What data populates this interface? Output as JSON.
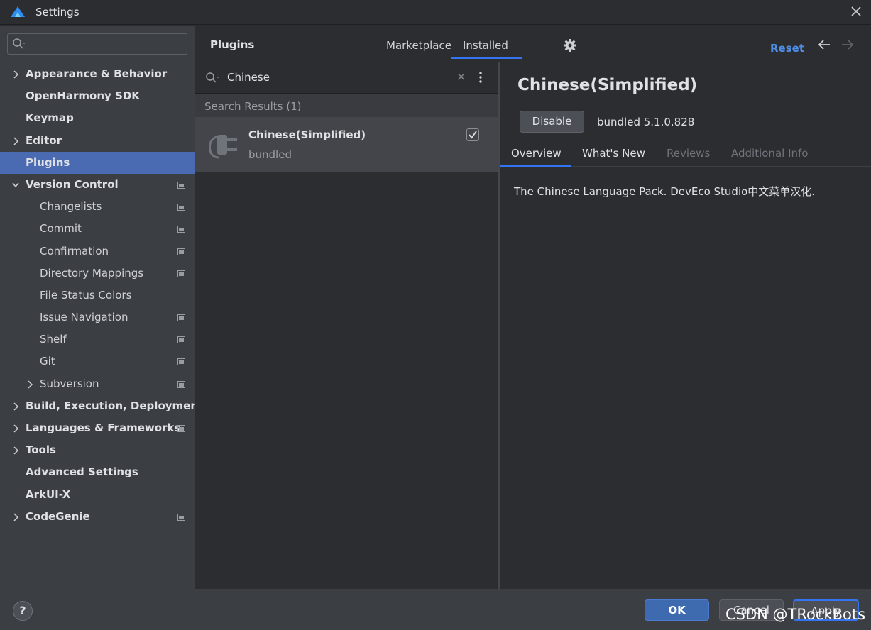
{
  "window": {
    "title": "Settings"
  },
  "sidebar": {
    "items": [
      {
        "label": "Appearance & Behavior",
        "level": 0,
        "expandable": true,
        "expanded": false
      },
      {
        "label": "OpenHarmony SDK",
        "level": 0,
        "expandable": false
      },
      {
        "label": "Keymap",
        "level": 0,
        "expandable": false
      },
      {
        "label": "Editor",
        "level": 0,
        "expandable": true,
        "expanded": false
      },
      {
        "label": "Plugins",
        "level": 0,
        "expandable": false,
        "selected": true
      },
      {
        "label": "Version Control",
        "level": 0,
        "expandable": true,
        "expanded": true,
        "project_icon": true
      },
      {
        "label": "Changelists",
        "level": 1,
        "project_icon": true
      },
      {
        "label": "Commit",
        "level": 1,
        "project_icon": true
      },
      {
        "label": "Confirmation",
        "level": 1,
        "project_icon": true
      },
      {
        "label": "Directory Mappings",
        "level": 1,
        "project_icon": true
      },
      {
        "label": "File Status Colors",
        "level": 1
      },
      {
        "label": "Issue Navigation",
        "level": 1,
        "project_icon": true
      },
      {
        "label": "Shelf",
        "level": 1,
        "project_icon": true
      },
      {
        "label": "Git",
        "level": 1,
        "project_icon": true
      },
      {
        "label": "Subversion",
        "level": 1,
        "expandable": true,
        "expanded": false,
        "project_icon": true
      },
      {
        "label": "Build, Execution, Deployment",
        "level": 0,
        "expandable": true,
        "expanded": false
      },
      {
        "label": "Languages & Frameworks",
        "level": 0,
        "expandable": true,
        "expanded": false,
        "project_icon": true
      },
      {
        "label": "Tools",
        "level": 0,
        "expandable": true,
        "expanded": false
      },
      {
        "label": "Advanced Settings",
        "level": 0,
        "expandable": false
      },
      {
        "label": "ArkUI-X",
        "level": 0,
        "expandable": false
      },
      {
        "label": "CodeGenie",
        "level": 0,
        "expandable": true,
        "expanded": false,
        "project_icon": true
      }
    ]
  },
  "header": {
    "title": "Plugins",
    "tabs": [
      {
        "label": "Marketplace",
        "active": false
      },
      {
        "label": "Installed",
        "active": true
      }
    ],
    "reset_label": "Reset"
  },
  "plugin_list": {
    "search_query": "Chinese",
    "results_header": "Search Results (1)",
    "items": [
      {
        "name": "Chinese(Simplified)",
        "subtitle": "bundled",
        "enabled": true
      }
    ]
  },
  "details": {
    "title": "Chinese(Simplified)",
    "disable_label": "Disable",
    "version": "bundled 5.1.0.828",
    "tabs": [
      {
        "label": "Overview",
        "active": true
      },
      {
        "label": "What's New",
        "active": false
      },
      {
        "label": "Reviews",
        "active": false,
        "disabled": true
      },
      {
        "label": "Additional Info",
        "active": false,
        "disabled": true
      }
    ],
    "description": "The Chinese Language Pack. DevEco Studio中文菜单汉化."
  },
  "footer": {
    "help_label": "?",
    "ok_label": "OK",
    "cancel_label": "Cancel",
    "apply_label": "Apply"
  },
  "watermark": "CSDN @TRockBots",
  "colors": {
    "accent": "#3574f0",
    "selection": "#4a6ab1",
    "link": "#4e8ee6"
  }
}
